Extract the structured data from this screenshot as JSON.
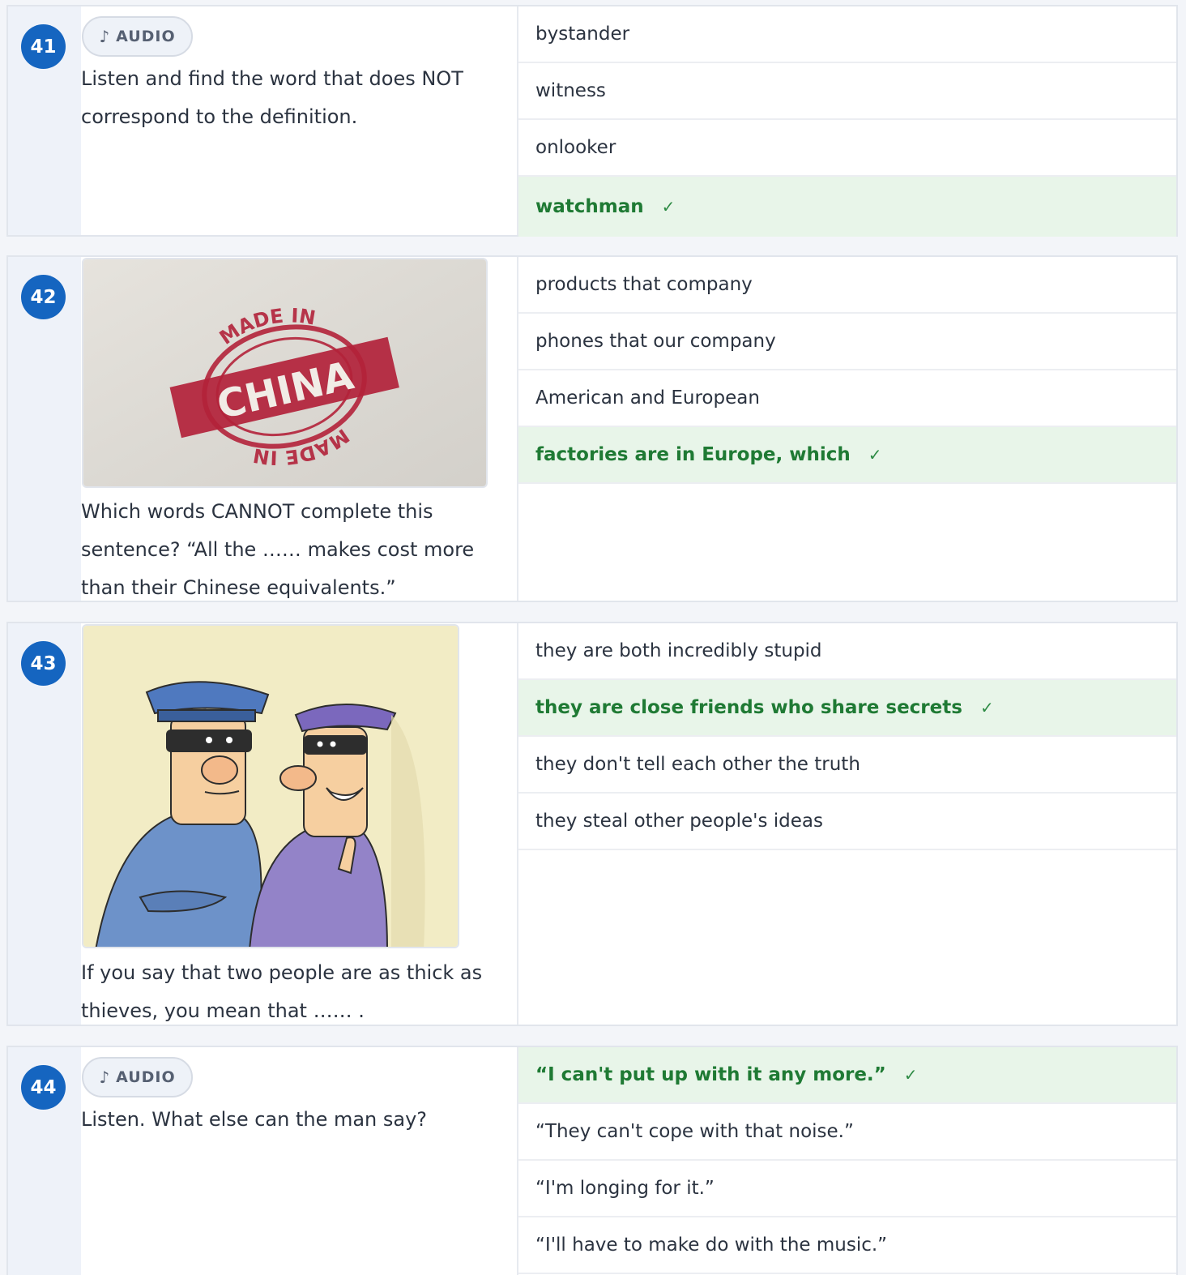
{
  "questions": [
    {
      "number": "41",
      "audio_label": "AUDIO",
      "prompt": "Listen and find the word that does NOT correspond to the definition.",
      "options": [
        {
          "text": "bystander",
          "correct": false
        },
        {
          "text": "witness",
          "correct": false
        },
        {
          "text": "onlooker",
          "correct": false
        },
        {
          "text": "watchman",
          "correct": true
        }
      ]
    },
    {
      "number": "42",
      "image": {
        "stamp_top": "MADE IN",
        "stamp_main": "CHINA",
        "stamp_bottom": "MADE IN"
      },
      "prompt": "Which words CANNOT complete this sentence? “All the …… makes cost more than their Chinese equivalents.”",
      "options": [
        {
          "text": "products that company",
          "correct": false
        },
        {
          "text": "phones that our company",
          "correct": false
        },
        {
          "text": "American and European",
          "correct": false
        },
        {
          "text": "factories are in Europe, which",
          "correct": true
        }
      ]
    },
    {
      "number": "43",
      "image": {
        "subject": "two-thieves-cartoon"
      },
      "prompt": "If you say that two people are as thick as thieves, you mean that …… .",
      "options": [
        {
          "text": "they are both incredibly stupid",
          "correct": false
        },
        {
          "text": "they are close friends who share secrets",
          "correct": true
        },
        {
          "text": "they don't tell each other the truth",
          "correct": false
        },
        {
          "text": "they steal other people's ideas",
          "correct": false
        }
      ]
    },
    {
      "number": "44",
      "audio_label": "AUDIO",
      "prompt": "Listen. What else can the man say?",
      "options": [
        {
          "text": "“I can't put up with it any more.”",
          "correct": true
        },
        {
          "text": "“They can't cope with that noise.”",
          "correct": false
        },
        {
          "text": "“I'm longing for it.”",
          "correct": false
        },
        {
          "text": "“I'll have to make do with the music.”",
          "correct": false
        }
      ]
    }
  ],
  "check_mark": "✓",
  "audio_icon": "♪",
  "colors": {
    "badge": "#1565c0",
    "correct_bg": "#e8f5e9",
    "correct_text": "#1f7a34",
    "number_column": "#eef2f9"
  }
}
